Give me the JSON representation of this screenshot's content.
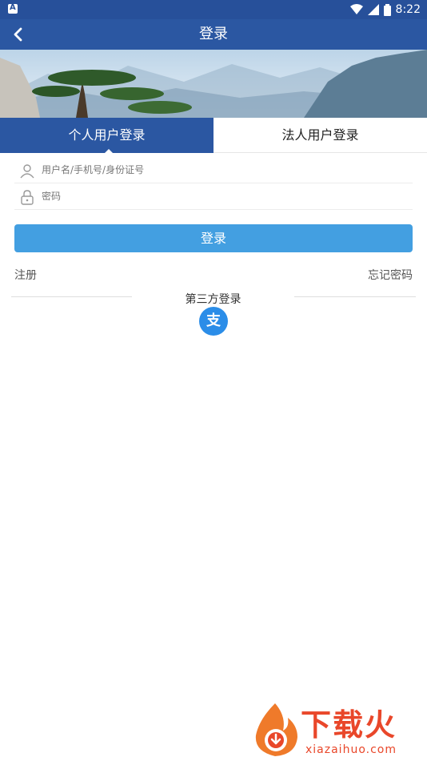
{
  "status_bar": {
    "time": "8:22"
  },
  "header": {
    "title": "登录"
  },
  "tabs": {
    "personal": "个人用户登录",
    "legal": "法人用户登录"
  },
  "form": {
    "username_placeholder": "用户名/手机号/身份证号",
    "password_placeholder": "密码",
    "login_label": "登录"
  },
  "links": {
    "register": "注册",
    "forgot": "忘记密码"
  },
  "third_party": {
    "label": "第三方登录",
    "alipay_glyph": "支"
  },
  "watermark": {
    "text": "下载火",
    "url": "xiazaihuo.com"
  },
  "colors": {
    "primary": "#2b57a2",
    "accent": "#439fe1",
    "alipay": "#2b8de8"
  },
  "icons": [
    "back-icon",
    "user-icon",
    "lock-icon",
    "wifi-icon",
    "signal-icon",
    "battery-icon",
    "alipay-icon"
  ]
}
